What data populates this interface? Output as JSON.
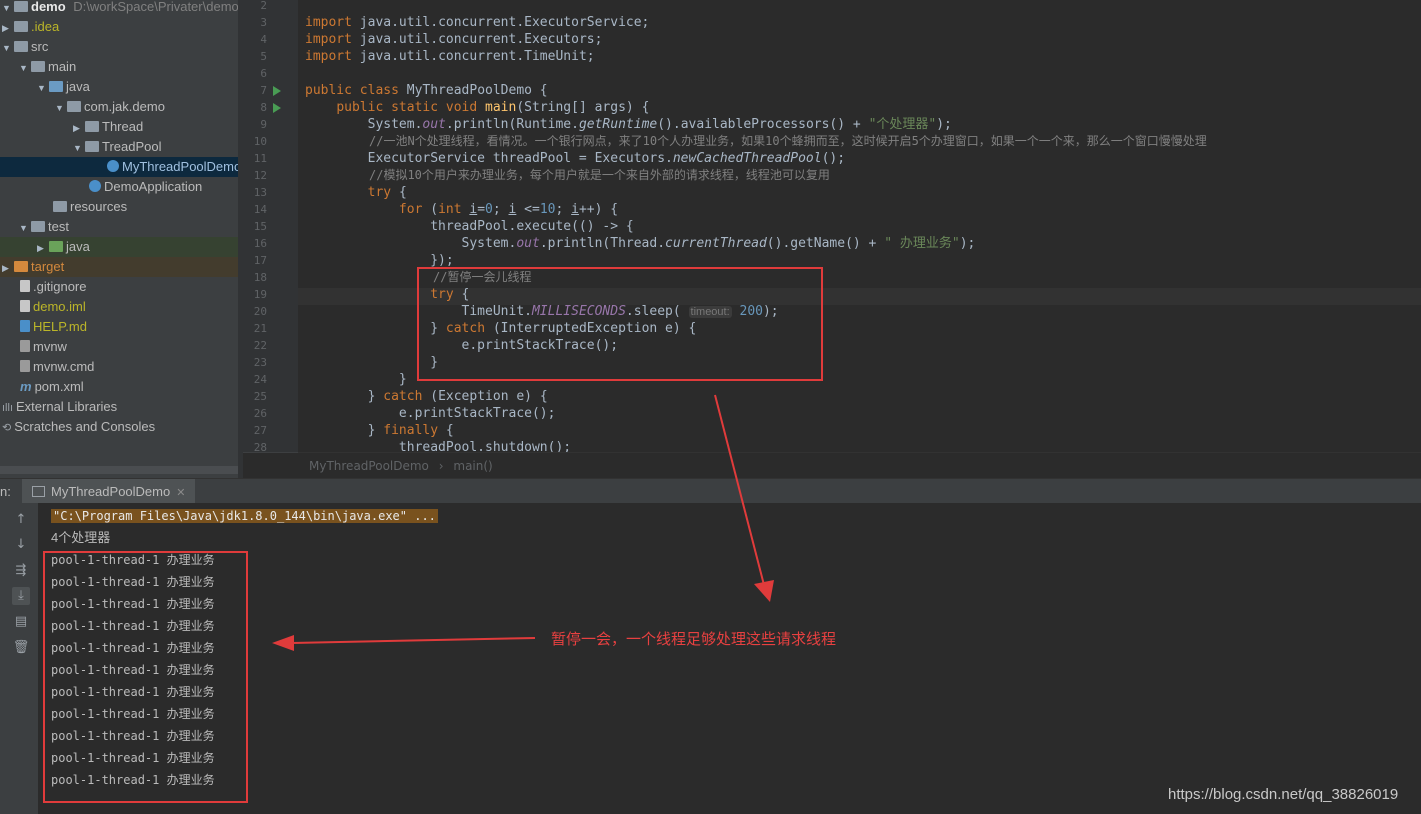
{
  "project_tree": {
    "root_name": "demo",
    "root_path": "D:\\workSpace\\Privater\\demo",
    "items": [
      {
        "label": "demo",
        "depth": 0
      },
      {
        "label": ".idea"
      },
      {
        "label": "src"
      },
      {
        "label": "main"
      },
      {
        "label": "java"
      },
      {
        "label": "com.jak.demo"
      },
      {
        "label": "Thread"
      },
      {
        "label": "TreadPool"
      },
      {
        "label": "MyThreadPoolDemo"
      },
      {
        "label": "DemoApplication"
      },
      {
        "label": "resources"
      },
      {
        "label": "test"
      },
      {
        "label": "java"
      },
      {
        "label": "target"
      },
      {
        "label": ".gitignore"
      },
      {
        "label": "demo.iml"
      },
      {
        "label": "HELP.md"
      },
      {
        "label": "mvnw"
      },
      {
        "label": "mvnw.cmd"
      },
      {
        "label": "pom.xml"
      },
      {
        "label": "External Libraries"
      },
      {
        "label": "Scratches and Consoles"
      }
    ]
  },
  "editor": {
    "line_numbers": [
      "2",
      "3",
      "4",
      "5",
      "6",
      "7",
      "8",
      "9",
      "10",
      "11",
      "12",
      "13",
      "14",
      "15",
      "16",
      "17",
      "18",
      "19",
      "20",
      "21",
      "22",
      "23",
      "24",
      "25",
      "26",
      "27",
      "28"
    ],
    "breadcrumb": {
      "class": "MyThreadPoolDemo",
      "method": "main()"
    },
    "code": {
      "l3": "import java.util.concurrent.ExecutorService;",
      "l4": "import java.util.concurrent.Executors;",
      "l5": "import java.util.concurrent.TimeUnit;",
      "l10_comment": "//一池N个处理线程，看情况。一个银行网点，来了10个人办理业务，如果10个蜂拥而至，这时候开启5个办理窗口，如果一个一个来，那么一个窗口慢慢处理",
      "l12_comment": "//模拟10个用户来办理业务，每个用户就是一个来自外部的请求线程，线程池可以复用",
      "l18_comment": "//暂停一会儿线程",
      "string_processors": "\"个处理器\"",
      "string_business": "\" 办理业务\"",
      "param_hint": "timeout:",
      "sleep_value": "200"
    }
  },
  "run_panel": {
    "label": "n:",
    "tab": "MyThreadPoolDemo",
    "command": "\"C:\\Program Files\\Java\\jdk1.8.0_144\\bin\\java.exe\" ...",
    "first_line": "4个处理器",
    "output_lines": [
      "pool-1-thread-1 办理业务",
      "pool-1-thread-1 办理业务",
      "pool-1-thread-1 办理业务",
      "pool-1-thread-1 办理业务",
      "pool-1-thread-1 办理业务",
      "pool-1-thread-1 办理业务",
      "pool-1-thread-1 办理业务",
      "pool-1-thread-1 办理业务",
      "pool-1-thread-1 办理业务",
      "pool-1-thread-1 办理业务",
      "pool-1-thread-1 办理业务"
    ]
  },
  "annotation": "暂停一会，一个线程足够处理这些请求线程",
  "watermark": "https://blog.csdn.net/qq_38826019",
  "colors": {
    "annotation_red": "#e03b3b",
    "keyword": "#cc7832",
    "string": "#6a8759",
    "number": "#6897bb"
  }
}
